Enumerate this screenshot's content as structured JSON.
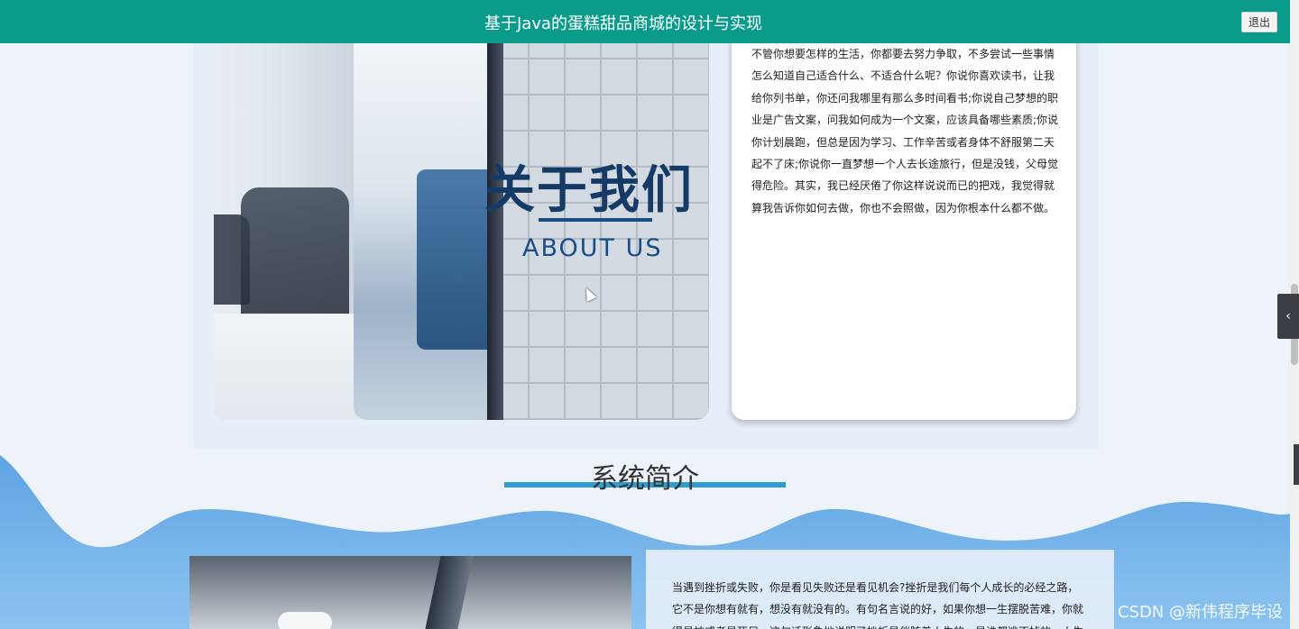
{
  "header": {
    "title": "基于Java的蛋糕甜品商城的设计与实现",
    "logout_label": "退出"
  },
  "about": {
    "image_title_cn": "关于我们",
    "image_title_en": "ABOUT US",
    "text": "不管你想要怎样的生活，你都要去努力争取，不多尝试一些事情怎么知道自己适合什么、不适合什么呢？你说你喜欢读书，让我给你列书单，你还问我哪里有那么多时间看书;你说自己梦想的职业是广告文案，问我如何成为一个文案，应该具备哪些素质;你说你计划晨跑，但总是因为学习、工作辛苦或者身体不舒服第二天起不了床;你说你一直梦想一个人去长途旅行，但是没钱，父母觉得危险。其实，我已经厌倦了你这样说说而已的把戏，我觉得就算我告诉你如何去做，你也不会照做，因为你根本什么都不做。"
  },
  "intro": {
    "title": "系统简介",
    "text": "当遇到挫折或失败，你是看见失败还是看见机会?挫折是我们每个人成长的必经之路，它不是你想有就有，想没有就没有的。有句名言说的好，如果你想一生摆脱苦难，你就得是神或者是死尸。这句话形象地说明了挫折是伴随着人生的，是谁都逃不掉的。人生"
  },
  "side": {
    "toggle_icon": "chevron-left-icon",
    "toggle_glyph": "‹"
  },
  "watermark": "CSDN @新伟程序毕设",
  "colors": {
    "header_bg": "#0a9b8a",
    "accent_line": "#2f9bd0",
    "wave_blue": "#6aaee8"
  }
}
